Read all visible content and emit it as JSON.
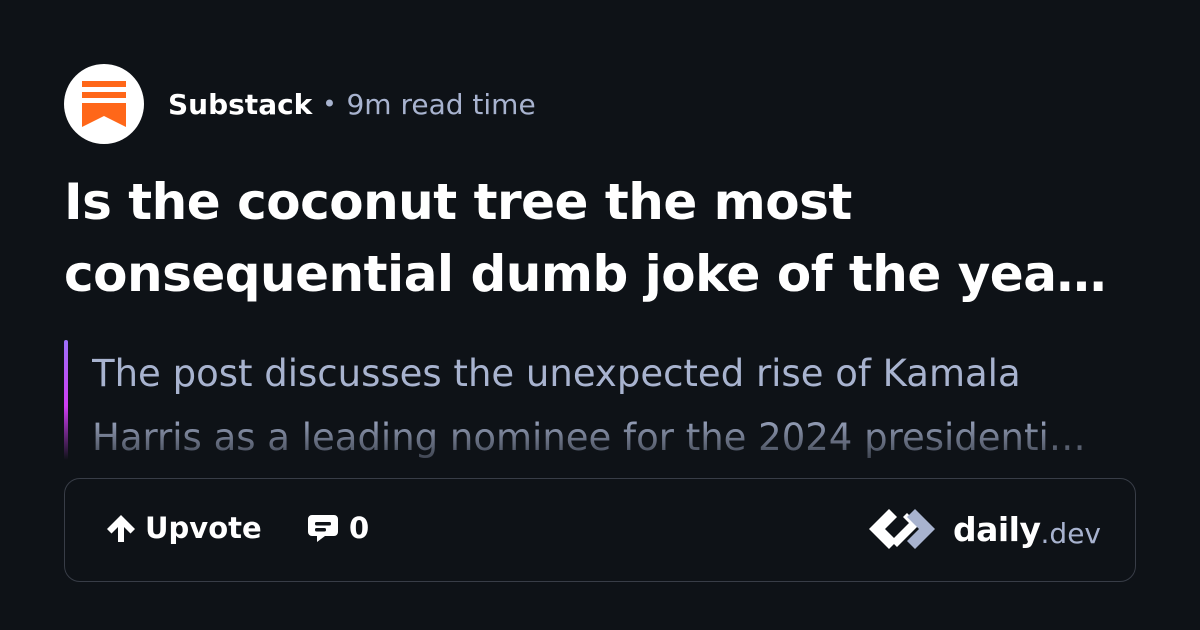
{
  "source": {
    "name": "Substack",
    "separator": "•",
    "read_time": "9m read time",
    "icon": "substack-logo-icon",
    "icon_color": "#ff6719"
  },
  "post": {
    "title_lines": [
      "Is the coconut tree the most",
      "consequential dumb joke of the yea…"
    ],
    "summary_lines": [
      "The post discusses the unexpected rise of Kamala",
      "Harris as a leading nominee for the 2024 presidenti…"
    ]
  },
  "actions": {
    "upvote_label": "Upvote",
    "upvote_icon": "arrow-up-icon",
    "comment_count": "0",
    "comment_icon": "comment-bubble-icon"
  },
  "brand": {
    "logo_icon": "daily-dev-logo-icon",
    "name_bold": "daily",
    "name_suffix": ".dev"
  },
  "colors": {
    "background": "#0e1217",
    "text_primary": "#ffffff",
    "text_secondary": "#a8b3cf",
    "border": "#383d47",
    "accent_gradient_start": "#9d70f8",
    "accent_gradient_end": "#ce3df3"
  }
}
